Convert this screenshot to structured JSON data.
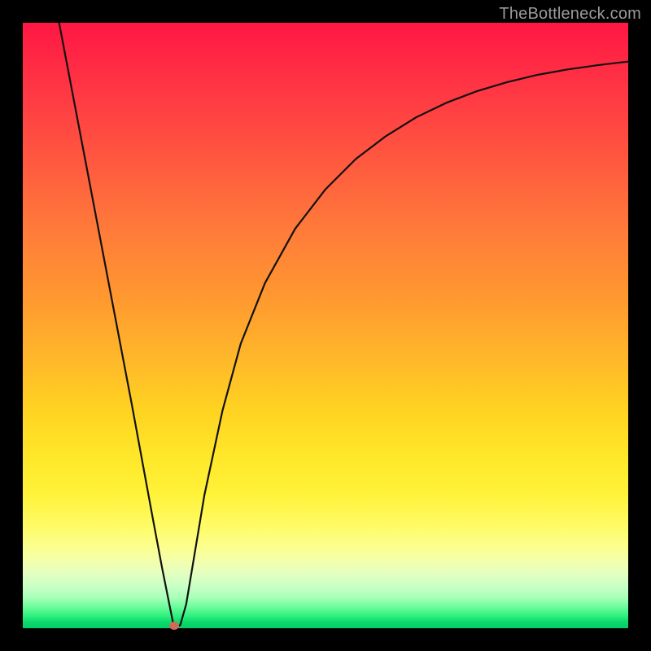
{
  "watermark": "TheBottleneck.com",
  "chart_data": {
    "type": "line",
    "title": "",
    "xlabel": "",
    "ylabel": "",
    "xlim": [
      0,
      100
    ],
    "ylim": [
      0,
      100
    ],
    "grid": false,
    "legend": false,
    "marker": {
      "x": 25,
      "y": 0
    },
    "series": [
      {
        "name": "curve",
        "x": [
          6,
          10,
          14,
          18,
          21.5,
          23,
          24,
          25,
          26,
          27,
          28,
          30,
          33,
          36,
          40,
          45,
          50,
          55,
          60,
          65,
          70,
          75,
          80,
          85,
          90,
          95,
          100
        ],
        "values": [
          100,
          79,
          58,
          37,
          18,
          10,
          5,
          0,
          0.5,
          4,
          10,
          22,
          36,
          47,
          57,
          66,
          72.5,
          77.5,
          81.3,
          84.4,
          86.8,
          88.7,
          90.2,
          91.4,
          92.3,
          93.0,
          93.6
        ]
      }
    ]
  }
}
